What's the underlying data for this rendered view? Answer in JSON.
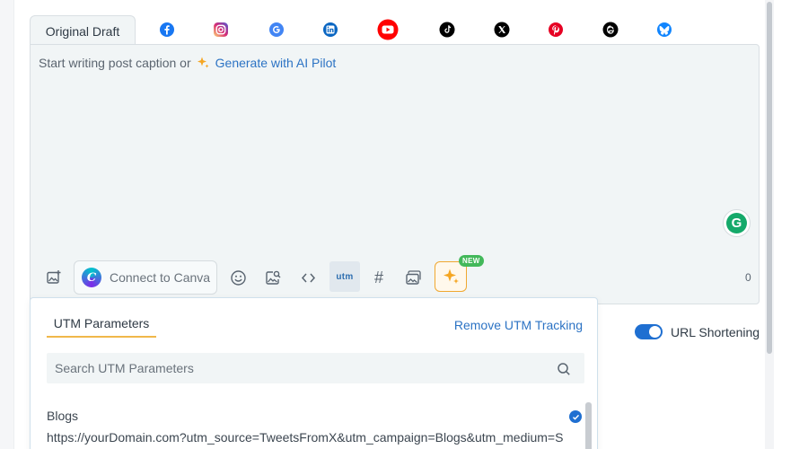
{
  "tabs": {
    "original_label": "Original Draft",
    "networks": [
      {
        "name": "Facebook",
        "color": "#1877f2"
      },
      {
        "name": "Instagram",
        "color": "#e1306c"
      },
      {
        "name": "Google Business",
        "color": "#4285f4"
      },
      {
        "name": "LinkedIn",
        "color": "#0a66c2"
      },
      {
        "name": "YouTube",
        "color": "#ff0000"
      },
      {
        "name": "TikTok",
        "color": "#000000"
      },
      {
        "name": "X",
        "color": "#000000"
      },
      {
        "name": "Pinterest",
        "color": "#e60023"
      },
      {
        "name": "Threads",
        "color": "#000000"
      },
      {
        "name": "Bluesky",
        "color": "#1185fe"
      }
    ]
  },
  "editor": {
    "caption_prompt": "Start writing post caption or",
    "ai_link": "Generate with AI Pilot",
    "grammarly_letter": "G",
    "char_count": "0"
  },
  "toolbar": {
    "canva_label": "Connect to Canva",
    "canva_letter": "C",
    "utm_label": "utm",
    "hashtag_glyph": "#",
    "new_badge": "NEW"
  },
  "utm_panel": {
    "tab_label": "UTM Parameters",
    "remove_link": "Remove UTM Tracking",
    "search_placeholder": "Search UTM Parameters",
    "items": [
      {
        "title": "Blogs",
        "url": "https://yourDomain.com?utm_source=TweetsFromX&utm_campaign=Blogs&utm_medium=S",
        "selected": true
      }
    ]
  },
  "url_shortening": {
    "label": "URL Shortening",
    "enabled": true
  },
  "colors": {
    "accent": "#1f6fd1",
    "link": "#2c73c4",
    "editor_bg": "#f1f5f6",
    "ai_border": "#f0a830",
    "badge_green": "#43b85a"
  }
}
